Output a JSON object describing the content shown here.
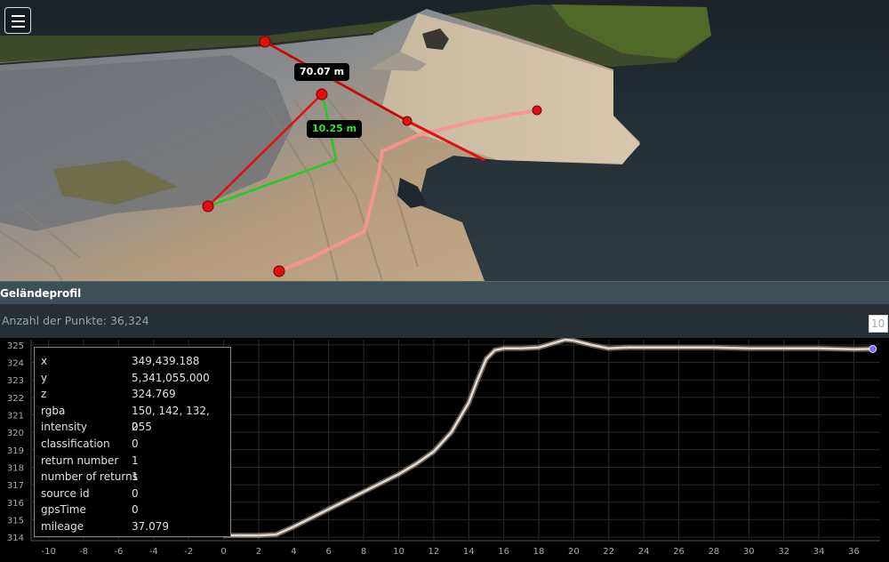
{
  "menu": {
    "icon": "hamburger-menu-icon"
  },
  "measurements": {
    "distance_label": "70.07 m",
    "height_label": "10.25 m",
    "colors": {
      "distance": "#e01010",
      "height": "#22cc22",
      "profile": "#ff9090"
    }
  },
  "profile": {
    "title": "Geländeprofil",
    "points_count": "Anzahl der Punkte: 36,324",
    "width_value": "10"
  },
  "info": [
    {
      "key": "x",
      "value": "349,439.188"
    },
    {
      "key": "y",
      "value": "5,341,055.000"
    },
    {
      "key": "z",
      "value": "324.769"
    },
    {
      "key": "rgba",
      "value": "150, 142, 132, 255"
    },
    {
      "key": "intensity",
      "value": "0"
    },
    {
      "key": "classification",
      "value": "0"
    },
    {
      "key": "return number",
      "value": "1"
    },
    {
      "key": "number of returns",
      "value": "1"
    },
    {
      "key": "source id",
      "value": "0"
    },
    {
      "key": "gpsTime",
      "value": "0"
    },
    {
      "key": "mileage",
      "value": "37.079"
    }
  ],
  "chart_data": {
    "type": "scatter",
    "xlim": [
      -11,
      37.5
    ],
    "ylim": [
      313.8,
      325.3
    ],
    "x_ticks": [
      -10,
      -8,
      -6,
      -4,
      -2,
      0,
      2,
      4,
      6,
      8,
      10,
      12,
      14,
      16,
      18,
      20,
      22,
      24,
      26,
      28,
      30,
      32,
      34,
      36
    ],
    "y_ticks": [
      314,
      315,
      316,
      317,
      318,
      319,
      320,
      321,
      322,
      323,
      324,
      325
    ],
    "grid": true,
    "series": [
      {
        "x": [
          0,
          1,
          2,
          3,
          4,
          5,
          6,
          7,
          8,
          9,
          10,
          11,
          12,
          13,
          14,
          14.5,
          15,
          15.5,
          16,
          17,
          18,
          19,
          19.5,
          20,
          21,
          22,
          23,
          24,
          26,
          28,
          30,
          32,
          34,
          36,
          37
        ],
        "y": [
          314.1,
          314.1,
          314.1,
          314.15,
          314.6,
          315.1,
          315.6,
          316.1,
          316.6,
          317.1,
          317.6,
          318.2,
          318.9,
          320.0,
          321.7,
          323.0,
          324.2,
          324.7,
          324.8,
          324.8,
          324.85,
          325.15,
          325.3,
          325.25,
          325.0,
          324.8,
          324.85,
          324.85,
          324.85,
          324.85,
          324.8,
          324.8,
          324.8,
          324.75,
          324.77
        ]
      }
    ],
    "highlight_point": {
      "x": 37.079,
      "y": 324.769,
      "color": "#7b6cf0"
    }
  }
}
